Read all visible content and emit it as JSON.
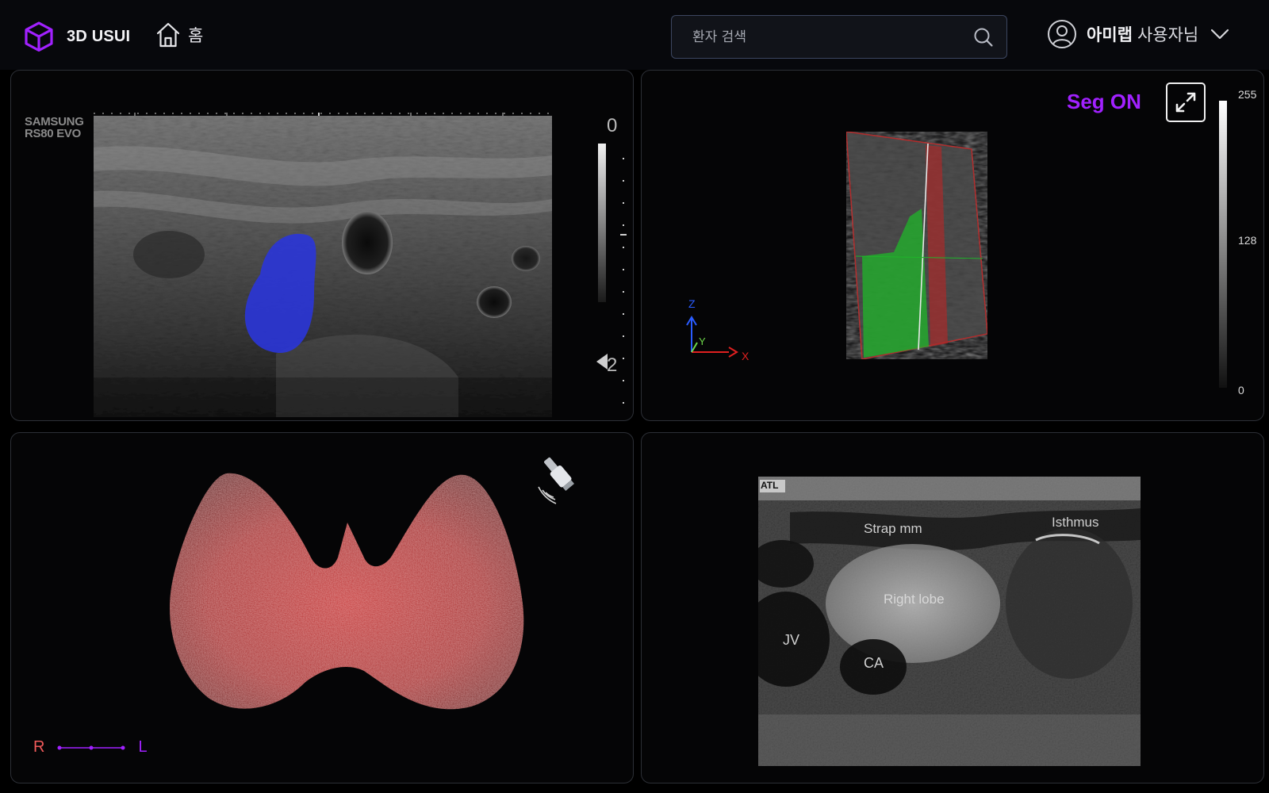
{
  "app": {
    "title": "3D USUI",
    "logo_icon": "cube-icon",
    "brand_color": "#a121ff"
  },
  "nav": {
    "home_label": "홈",
    "home_icon": "home-icon"
  },
  "search": {
    "placeholder": "환자 검색",
    "value": "",
    "icon": "search-icon"
  },
  "user": {
    "name": "아미랩",
    "suffix": "사용자님",
    "icon": "user-avatar-icon",
    "menu_icon": "chevron-down-icon"
  },
  "panels": {
    "ultrasound_2d": {
      "device_brand_line1": "SAMSUNG",
      "device_brand_line2": "RS80 EVO",
      "depth_top": "0",
      "depth_bottom": "2",
      "segmentation_color": "#2a35d8"
    },
    "volume_3d": {
      "seg_label": "Seg ON",
      "expand_icon": "expand-icon",
      "colorbar_max": "255",
      "colorbar_mid": "128",
      "colorbar_min": "0",
      "axis_x": "X",
      "axis_y": "Y",
      "axis_z": "Z",
      "axis_x_color": "#e02020",
      "axis_y_color": "#6ed94a",
      "axis_z_color": "#2a5cff"
    },
    "thyroid_model": {
      "orientation_right": "R",
      "orientation_left": "L",
      "probe_icon": "ultrasound-probe-icon",
      "model_color": "#c01a1a"
    },
    "annotated_ultrasound": {
      "device_tag": "ATL",
      "labels": [
        "Strap mm",
        "Isthmus",
        "Right lobe",
        "JV",
        "CA"
      ]
    }
  }
}
